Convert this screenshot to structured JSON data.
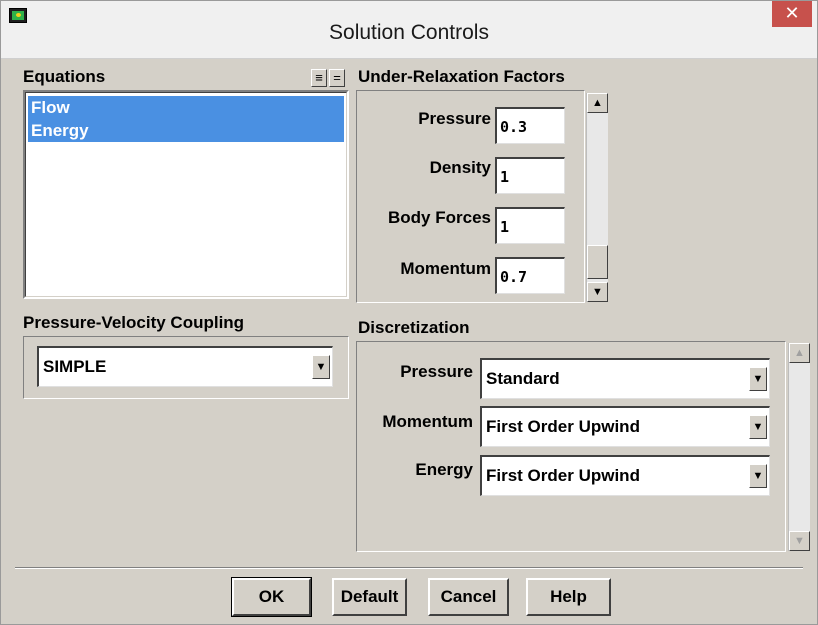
{
  "window": {
    "title": "Solution Controls",
    "close_glyph": "✕"
  },
  "equations": {
    "label": "Equations",
    "items": [
      "Flow",
      "Energy"
    ],
    "select_all_glyph": "≡",
    "deselect_all_glyph": "="
  },
  "under_relaxation": {
    "label": "Under-Relaxation Factors",
    "fields": [
      {
        "label": "Pressure",
        "value": "0.3"
      },
      {
        "label": "Density",
        "value": "1"
      },
      {
        "label": "Body Forces",
        "value": "1"
      },
      {
        "label": "Momentum",
        "value": "0.7"
      }
    ]
  },
  "coupling": {
    "label": "Pressure-Velocity Coupling",
    "selected": "SIMPLE"
  },
  "discretization": {
    "label": "Discretization",
    "rows": [
      {
        "label": "Pressure",
        "selected": "Standard"
      },
      {
        "label": "Momentum",
        "selected": "First Order Upwind"
      },
      {
        "label": "Energy",
        "selected": "First Order Upwind"
      }
    ]
  },
  "buttons": {
    "ok": "OK",
    "default": "Default",
    "cancel": "Cancel",
    "help": "Help"
  },
  "icons": {
    "app": "fluent-app-icon",
    "close": "close-icon",
    "dropdown": "chevron-down-icon",
    "scroll_up": "arrow-up-icon",
    "scroll_down": "arrow-down-icon"
  }
}
